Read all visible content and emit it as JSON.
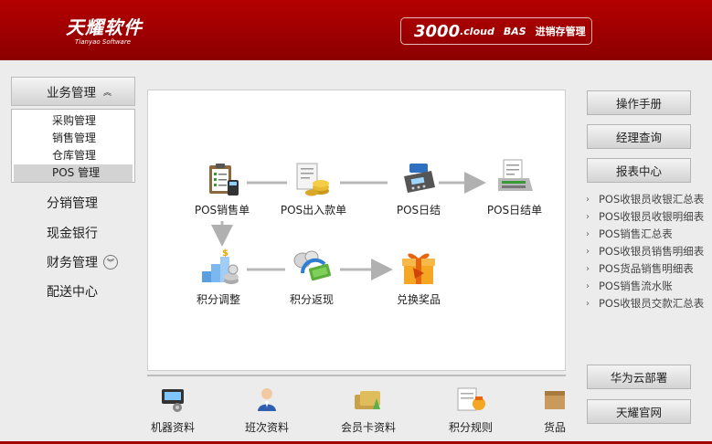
{
  "header": {
    "logo_title": "天耀软件",
    "logo_subtitle": "Tianyao Software",
    "product_version": "3000",
    "product_cloud": ".cloud",
    "product_bas": "BAS",
    "product_system": "进销存管理"
  },
  "sidebar": {
    "head_label": "业务管理",
    "head_chevron": "«",
    "submenu": [
      {
        "label": "采购管理"
      },
      {
        "label": "销售管理"
      },
      {
        "label": "仓库管理"
      },
      {
        "label": "POS 管理"
      }
    ],
    "items": [
      {
        "label": "分销管理"
      },
      {
        "label": "现金银行"
      },
      {
        "label": "财务管理"
      },
      {
        "label": "配送中心"
      }
    ]
  },
  "workflow": {
    "nodes": [
      {
        "label": "POS销售单",
        "icon": "clipboard-icon"
      },
      {
        "label": "POS出入款单",
        "icon": "receipt-coins-icon"
      },
      {
        "label": "POS日结",
        "icon": "card-reader-icon"
      },
      {
        "label": "POS日结单",
        "icon": "printer-report-icon"
      },
      {
        "label": "积分调整",
        "icon": "coin-stack-icon"
      },
      {
        "label": "积分返现",
        "icon": "cash-return-icon"
      },
      {
        "label": "兑换奖品",
        "icon": "gift-icon"
      }
    ]
  },
  "bottom": {
    "items": [
      {
        "label": "机器资料",
        "icon": "machine-icon"
      },
      {
        "label": "班次资料",
        "icon": "staff-icon"
      },
      {
        "label": "会员卡资料",
        "icon": "member-card-icon"
      },
      {
        "label": "积分规则",
        "icon": "points-rule-icon"
      },
      {
        "label": "货品",
        "icon": "goods-icon"
      }
    ]
  },
  "right_panel": {
    "manual": "操作手册",
    "manager_query": "经理查询",
    "report_center": "报表中心",
    "reports": [
      "POS收银员收银汇总表",
      "POS收银员收银明细表",
      "POS销售汇总表",
      "POS收银员销售明细表",
      "POS货品销售明细表",
      "POS销售流水账",
      "POS收银员交款汇总表"
    ],
    "huawei": "华为云部署",
    "official_site": "天耀官网"
  },
  "colors": {
    "header_red": "#a50000",
    "accent_orange": "#f5a623"
  }
}
